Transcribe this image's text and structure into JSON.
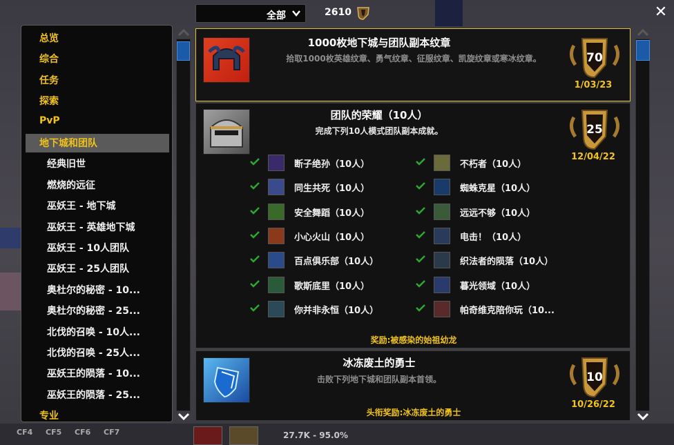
{
  "filter": {
    "label": "全部"
  },
  "points": "2610",
  "categories": [
    {
      "label": "总览",
      "type": "cat"
    },
    {
      "label": "综合",
      "type": "cat"
    },
    {
      "label": "任务",
      "type": "cat"
    },
    {
      "label": "探索",
      "type": "cat"
    },
    {
      "label": "PvP",
      "type": "cat"
    },
    {
      "label": "地下城和团队",
      "type": "cat",
      "selected": true
    },
    {
      "label": "经典旧世",
      "type": "sub"
    },
    {
      "label": "燃烧的远征",
      "type": "sub"
    },
    {
      "label": "巫妖王 - 地下城",
      "type": "sub"
    },
    {
      "label": "巫妖王 - 英雄地下城",
      "type": "sub"
    },
    {
      "label": "巫妖王 - 10人团队",
      "type": "sub"
    },
    {
      "label": "巫妖王 - 25人团队",
      "type": "sub"
    },
    {
      "label": "奥杜尔的秘密 - 10...",
      "type": "sub"
    },
    {
      "label": "奥杜尔的秘密 - 25...",
      "type": "sub"
    },
    {
      "label": "北伐的召唤 - 10人...",
      "type": "sub"
    },
    {
      "label": "北伐的召唤 - 25人...",
      "type": "sub"
    },
    {
      "label": "巫妖王的陨落 - 10...",
      "type": "sub"
    },
    {
      "label": "巫妖王的陨落 - 25...",
      "type": "sub"
    },
    {
      "label": "专业",
      "type": "cat"
    }
  ],
  "achievements": [
    {
      "title": "1000枚地下城与团队副本纹章",
      "desc": "拾取1000枚英雄纹章、勇气纹章、征服纹章、凯旋纹章或寒冰纹章。",
      "points": "70",
      "date": "1/03/23",
      "icon": "helmet-red-icon"
    },
    {
      "title": "团队的荣耀（10人）",
      "desc": "完成下列10人模式团队副本成就。",
      "points": "25",
      "date": "12/04/22",
      "icon": "steel-helm-icon",
      "reward": "奖励:被感染的始祖幼龙",
      "criteria": [
        "断子绝孙（10人）",
        "同生共死（10人）",
        "安全舞蹈（10人）",
        "小心火山（10人）",
        "百点俱乐部（10人）",
        "歌斯底里（10人）",
        "你并非永恒（10人）",
        "不朽者（10人）",
        "蜘蛛克星（10人）",
        "远远不够（10人）",
        "电击！（10人）",
        "织法者的陨落（10人）",
        "暮光领域（10人）",
        "帕奇维克陪你玩（10..."
      ]
    },
    {
      "title": "冰冻废土的勇士",
      "desc": "击败下列地下城和团队副本首领。",
      "points": "10",
      "date": "10/26/22",
      "icon": "blue-shield-icon",
      "reward": "头衔奖励:冰冻废土的勇士"
    }
  ],
  "bottom": {
    "keys": [
      "CF4",
      "CF5",
      "CF6",
      "CF7"
    ],
    "status": "27.7K - 95.0%"
  },
  "colors": {
    "gold": "#f0c21a",
    "highlight": "#e0c040",
    "scroll": "#1a5aa8"
  }
}
